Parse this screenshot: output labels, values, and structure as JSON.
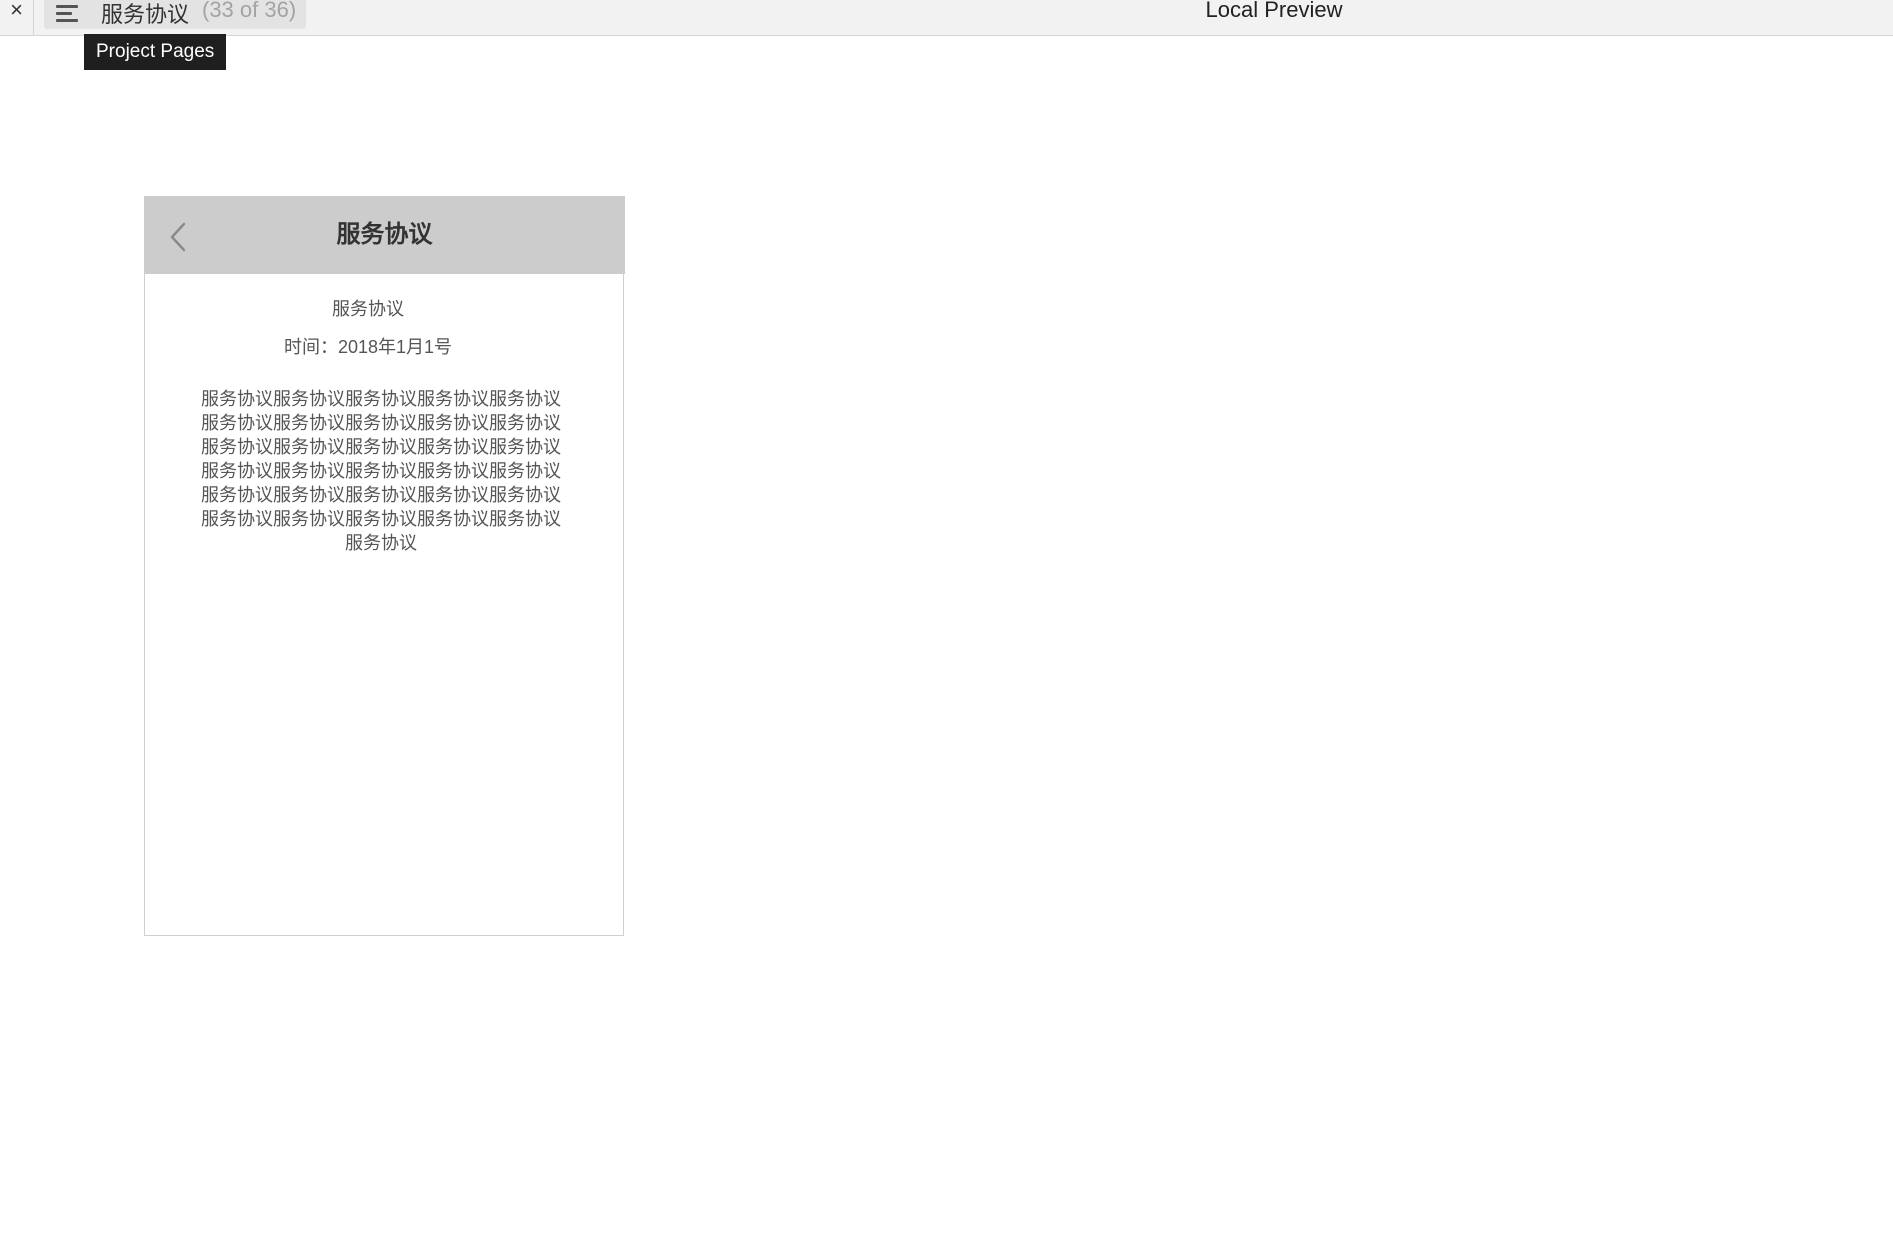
{
  "toolbar": {
    "close_label": "×",
    "page_name": "服务协议",
    "page_count": "(33 of 36)",
    "app_title": "Local Preview",
    "tooltip": "Project Pages"
  },
  "icons": {
    "close": "close-icon",
    "menu": "menu-icon",
    "back": "chevron-left-icon"
  },
  "phone": {
    "header_title": "服务协议",
    "doc_title": "服务协议",
    "doc_date": "时间：2018年1月1号",
    "doc_body": "服务协议服务协议服务协议服务协议服务协议服务协议服务协议服务协议服务协议服务协议服务协议服务协议服务协议服务协议服务协议服务协议服务协议服务协议服务协议服务协议服务协议服务协议服务协议服务协议服务协议服务协议服务协议服务协议服务协议服务协议服务协议"
  },
  "colors": {
    "toolbar_bg": "#f2f2f2",
    "selector_bg": "#e3e3e3",
    "tooltip_bg": "#1f1f1f",
    "phone_header_bg": "#cccccc",
    "muted_text": "#a3a3a3"
  }
}
